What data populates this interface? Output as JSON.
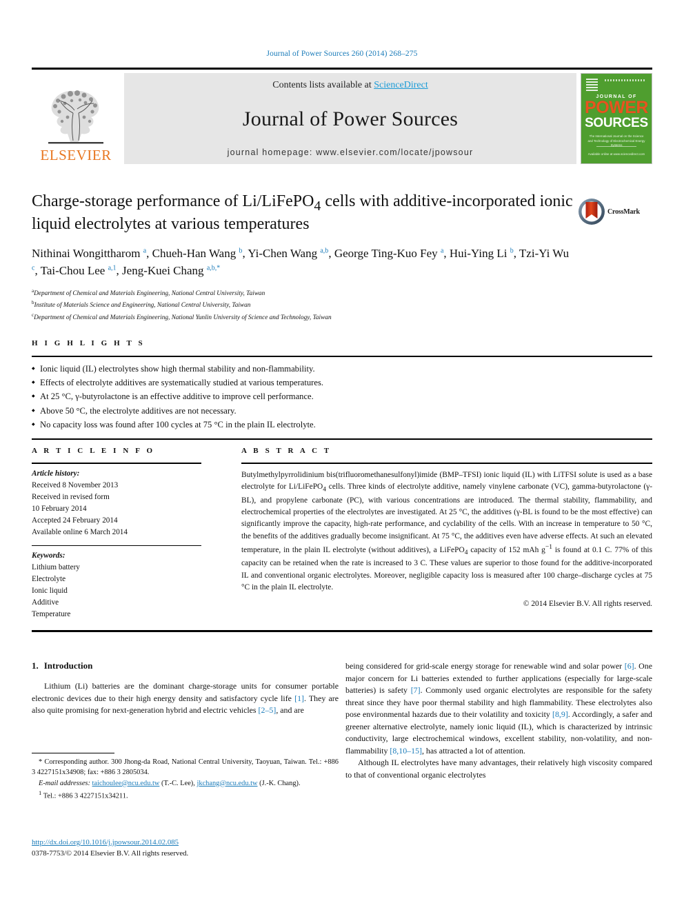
{
  "running_head": "Journal of Power Sources 260 (2014) 268–275",
  "masthead": {
    "contents_prefix": "Contents lists available at ",
    "sciencedirect": "ScienceDirect",
    "journal_title": "Journal of Power Sources",
    "homepage": "journal homepage: www.elsevier.com/locate/jpowsour",
    "publisher_wordmark": "ELSEVIER",
    "cover": {
      "journal_of": "JOURNAL OF",
      "power": "POWER",
      "sources": "SOURCES",
      "subtitle": "The International Journal on the Science and Technology of Electrochemical Energy Systems",
      "footer": "Available online at www.sciencedirect.com"
    },
    "accent_blue": "#1a9bd7",
    "band_gray": "#e6e6e6",
    "elsevier_orange": "#E87722",
    "cover_green": "#4f9e2f"
  },
  "article": {
    "title": "Charge-storage performance of Li/LiFePO4 cells with additive-incorporated ionic liquid electrolytes at various temperatures",
    "crossmark_label": "CrossMark",
    "authors_html": "Nithinai Wongittharom <sup>a</sup>, Chueh-Han Wang <sup>b</sup>, Yi-Chen Wang <sup>a,b</sup>, George Ting-Kuo Fey <sup>a</sup>, Hui-Ying Li <sup>b</sup>, Tzi-Yi Wu <sup>c</sup>, Tai-Chou Lee <sup>a,1</sup>, Jeng-Kuei Chang <sup>a,b,*</sup>",
    "affiliations": [
      {
        "marker": "a",
        "text": "Department of Chemical and Materials Engineering, National Central University, Taiwan"
      },
      {
        "marker": "b",
        "text": "Institute of Materials Science and Engineering, National Central University, Taiwan"
      },
      {
        "marker": "c",
        "text": "Department of Chemical and Materials Engineering, National Yunlin University of Science and Technology, Taiwan"
      }
    ]
  },
  "highlights": {
    "heading": "H I G H L I G H T S",
    "items": [
      "Ionic liquid (IL) electrolytes show high thermal stability and non-flammability.",
      "Effects of electrolyte additives are systematically studied at various temperatures.",
      "At 25 °C, γ-butyrolactone is an effective additive to improve cell performance.",
      "Above 50 °C, the electrolyte additives are not necessary.",
      "No capacity loss was found after 100 cycles at 75 °C in the plain IL electrolyte."
    ]
  },
  "article_info": {
    "heading": "A R T I C L E   I N F O",
    "history_label": "Article history:",
    "history": [
      "Received 8 November 2013",
      "Received in revised form",
      "10 February 2014",
      "Accepted 24 February 2014",
      "Available online 6 March 2014"
    ],
    "keywords_label": "Keywords:",
    "keywords": [
      "Lithium battery",
      "Electrolyte",
      "Ionic liquid",
      "Additive",
      "Temperature"
    ]
  },
  "abstract": {
    "heading": "A B S T R A C T",
    "text": "Butylmethylpyrrolidinium bis(trifluoromethanesulfonyl)imide (BMP–TFSI) ionic liquid (IL) with LiTFSI solute is used as a base electrolyte for Li/LiFePO4 cells. Three kinds of electrolyte additive, namely vinylene carbonate (VC), gamma-butyrolactone (γ-BL), and propylene carbonate (PC), with various concentrations are introduced. The thermal stability, flammability, and electrochemical properties of the electrolytes are investigated. At 25 °C, the additives (γ-BL is found to be the most effective) can significantly improve the capacity, high-rate performance, and cyclability of the cells. With an increase in temperature to 50 °C, the benefits of the additives gradually become insignificant. At 75 °C, the additives even have adverse effects. At such an elevated temperature, in the plain IL electrolyte (without additives), a LiFePO4 capacity of 152 mAh g−1 is found at 0.1 C. 77% of this capacity can be retained when the rate is increased to 3 C. These values are superior to those found for the additive-incorporated IL and conventional organic electrolytes. Moreover, negligible capacity loss is measured after 100 charge–discharge cycles at 75 °C in the plain IL electrolyte.",
    "copyright": "© 2014 Elsevier B.V. All rights reserved."
  },
  "introduction": {
    "number": "1.",
    "heading": "Introduction",
    "left_paragraph": "Lithium (Li) batteries are the dominant charge-storage units for consumer portable electronic devices due to their high energy density and satisfactory cycle life [1]. They are also quite promising for next-generation hybrid and electric vehicles [2–5], and are",
    "right_paragraph_1": "being considered for grid-scale energy storage for renewable wind and solar power [6]. One major concern for Li batteries extended to further applications (especially for large-scale batteries) is safety [7]. Commonly used organic electrolytes are responsible for the safety threat since they have poor thermal stability and high flammability. These electrolytes also pose environmental hazards due to their volatility and toxicity [8,9]. Accordingly, a safer and greener alternative electrolyte, namely ionic liquid (IL), which is characterized by intrinsic conductivity, large electrochemical windows, excellent stability, non-volatility, and non-flammability [8,10–15], has attracted a lot of attention.",
    "right_paragraph_2": "Although IL electrolytes have many advantages, their relatively high viscosity compared to that of conventional organic electrolytes"
  },
  "footnote": {
    "corresponding": "* Corresponding author. 300 Jhong-da Road, National Central University, Taoyuan, Taiwan. Tel.: +886 3 4227151x34908; fax: +886 3 2805034.",
    "email_label": "E-mail addresses:",
    "email_1": "taichoulee@ncu.edu.tw",
    "email_1_name": "(T.-C. Lee),",
    "email_2": "jkchang@ncu.edu.tw",
    "email_2_name": "(J.-K. Chang).",
    "tel_marker": "1",
    "tel": "Tel.: +886 3 4227151x34211."
  },
  "footer": {
    "doi": "http://dx.doi.org/10.1016/j.jpowsour.2014.02.085",
    "issn": "0378-7753/© 2014 Elsevier B.V. All rights reserved."
  }
}
